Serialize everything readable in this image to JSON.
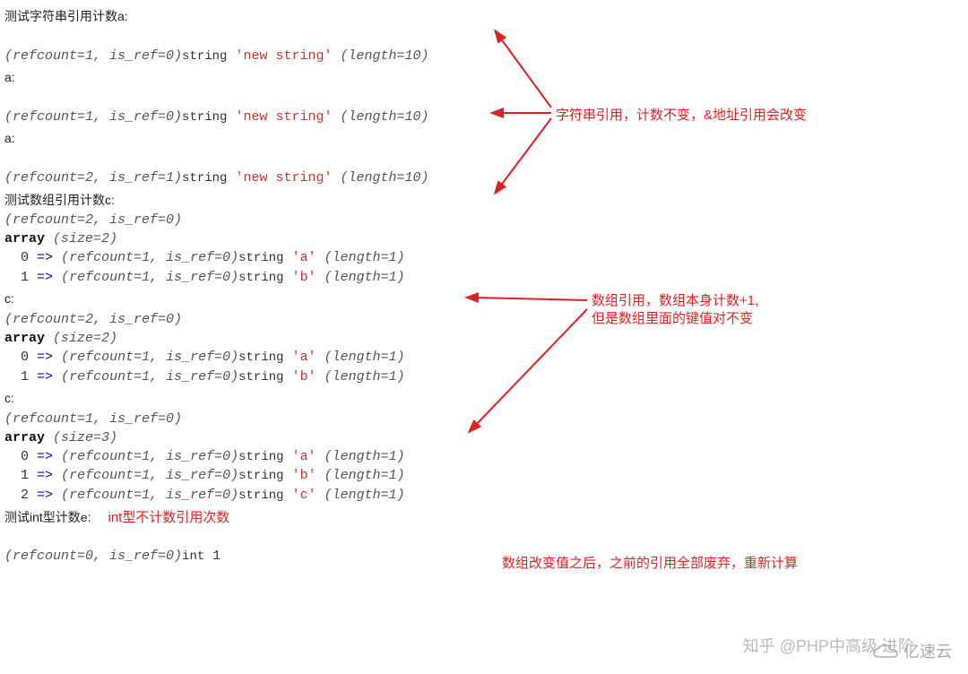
{
  "headers": {
    "h1": "测试字符串引用计数a:",
    "h2": "a:",
    "h3": "a:",
    "h4": "测试数组引用计数c:",
    "h5": "c:",
    "h6": "c:",
    "h7": "测试int型计数e:"
  },
  "lines": {
    "l1": {
      "pre": "(refcount=1, is_ref=0)",
      "type": "string",
      "val": "'new string'",
      "len": "(length=10)"
    },
    "l2": {
      "pre": "(refcount=1, is_ref=0)",
      "type": "string",
      "val": "'new string'",
      "len": "(length=10)"
    },
    "l3": {
      "pre": "(refcount=2, is_ref=1)",
      "type": "string",
      "val": "'new string'",
      "len": "(length=10)"
    },
    "arr1": {
      "pre": "(refcount=2, is_ref=0)",
      "hdr": "array",
      "size": "(size=2)",
      "r0": {
        "idx": "0",
        "arrow": "=>",
        "pre": "(refcount=1, is_ref=0)",
        "type": "string",
        "val": "'a'",
        "len": "(length=1)"
      },
      "r1": {
        "idx": "1",
        "arrow": "=>",
        "pre": "(refcount=1, is_ref=0)",
        "type": "string",
        "val": "'b'",
        "len": "(length=1)"
      }
    },
    "arr2": {
      "pre": "(refcount=2, is_ref=0)",
      "hdr": "array",
      "size": "(size=2)",
      "r0": {
        "idx": "0",
        "arrow": "=>",
        "pre": "(refcount=1, is_ref=0)",
        "type": "string",
        "val": "'a'",
        "len": "(length=1)"
      },
      "r1": {
        "idx": "1",
        "arrow": "=>",
        "pre": "(refcount=1, is_ref=0)",
        "type": "string",
        "val": "'b'",
        "len": "(length=1)"
      }
    },
    "arr3": {
      "pre": "(refcount=1, is_ref=0)",
      "hdr": "array",
      "size": "(size=3)",
      "r0": {
        "idx": "0",
        "arrow": "=>",
        "pre": "(refcount=1, is_ref=0)",
        "type": "string",
        "val": "'a'",
        "len": "(length=1)"
      },
      "r1": {
        "idx": "1",
        "arrow": "=>",
        "pre": "(refcount=1, is_ref=0)",
        "type": "string",
        "val": "'b'",
        "len": "(length=1)"
      },
      "r2": {
        "idx": "2",
        "arrow": "=>",
        "pre": "(refcount=1, is_ref=0)",
        "type": "string",
        "val": "'c'",
        "len": "(length=1)"
      }
    },
    "lint": {
      "pre": "(refcount=0, is_ref=0)",
      "type": "int",
      "val": "1"
    }
  },
  "notes": {
    "n1": "字符串引用，计数不变，&地址引用会改变",
    "n2a": "数组引用，数组本身计数+1,",
    "n2b": "但是数组里面的键值对不变",
    "n3": "数组改变值之后，之前的引用全部废弃，重新计算",
    "n4": "int型不计数引用次数"
  },
  "watermark": {
    "zhihu": "知乎 @PHP中高级 进阶",
    "yisu": "亿速云"
  }
}
